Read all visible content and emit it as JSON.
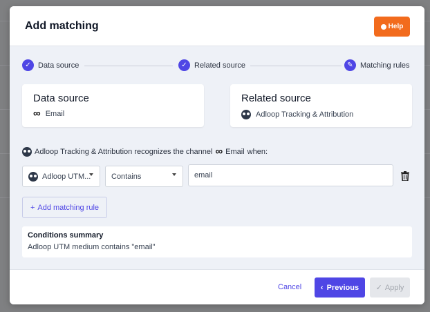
{
  "modal": {
    "title": "Add matching",
    "help_label": "Help"
  },
  "stepper": {
    "steps": [
      {
        "label": "Data source",
        "state": "done"
      },
      {
        "label": "Related source",
        "state": "done"
      },
      {
        "label": "Matching rules",
        "state": "current"
      }
    ]
  },
  "cards": {
    "data_source": {
      "title": "Data source",
      "value": "Email",
      "icon": "infinity-icon"
    },
    "related_source": {
      "title": "Related source",
      "value": "Adloop Tracking & Attribution",
      "icon": "owl-icon"
    }
  },
  "rule": {
    "recognize_prefix": "Adloop Tracking & Attribution recognizes the channel",
    "recognize_channel": "Email",
    "recognize_suffix": "when:",
    "field_value": "Adloop UTM...",
    "operator_value": "Contains",
    "match_value": "email"
  },
  "add_rule_label": "Add matching rule",
  "summary": {
    "title": "Conditions summary",
    "text": "Adloop UTM medium contains \"email\""
  },
  "footer": {
    "cancel_label": "Cancel",
    "previous_label": "Previous",
    "apply_label": "Apply"
  },
  "colors": {
    "accent": "#4f46e5",
    "help": "#f26b1d"
  }
}
